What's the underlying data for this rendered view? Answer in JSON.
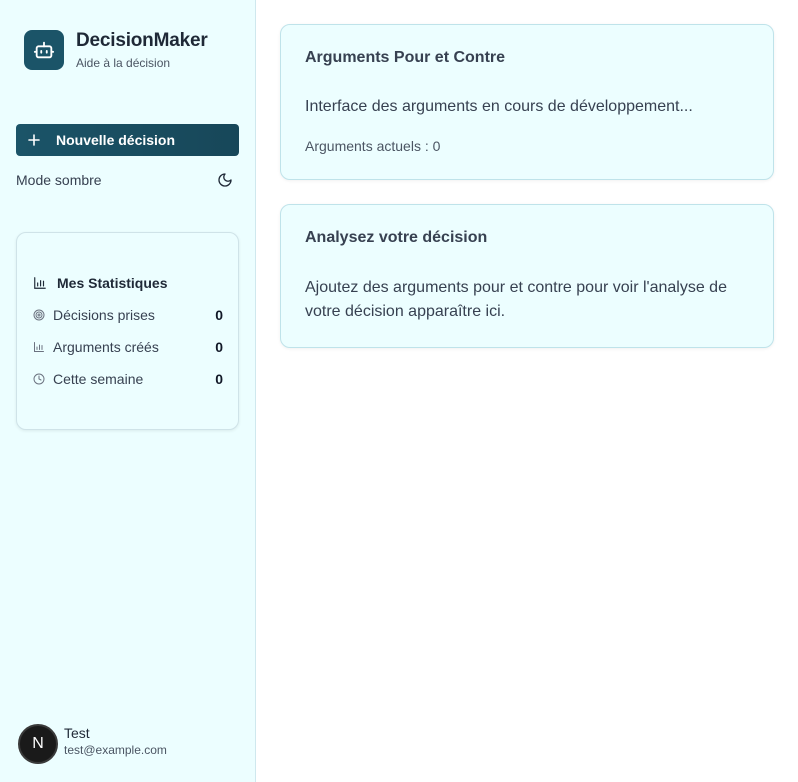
{
  "brand": {
    "title": "DecisionMaker",
    "subtitle": "Aide à la décision",
    "icon": "robot-icon",
    "color": "#1b5468"
  },
  "sidebar": {
    "new_decision_label": "Nouvelle décision",
    "dark_mode_label": "Mode sombre",
    "dark_mode_icon": "moon-icon"
  },
  "stats": {
    "title": "Mes Statistiques",
    "items": [
      {
        "label": "Décisions prises",
        "value": "0",
        "icon": "target-icon"
      },
      {
        "label": "Arguments créés",
        "value": "0",
        "icon": "bar-chart-icon"
      },
      {
        "label": "Cette semaine",
        "value": "0",
        "icon": "clock-icon"
      }
    ]
  },
  "user": {
    "initial": "N",
    "name": "Test",
    "email": "test@example.com"
  },
  "main": {
    "arguments_card": {
      "title": "Arguments Pour et Contre",
      "body": "Interface des arguments en cours de développement...",
      "meta": "Arguments actuels : 0"
    },
    "analysis_card": {
      "title": "Analysez votre décision",
      "body": "Ajoutez des arguments pour et contre pour voir l'analyse de votre décision apparaître ici."
    }
  },
  "colors": {
    "sidebar_bg": "#ecfeff",
    "accent": "#1b5468",
    "card_bg": "#ecfeff"
  }
}
